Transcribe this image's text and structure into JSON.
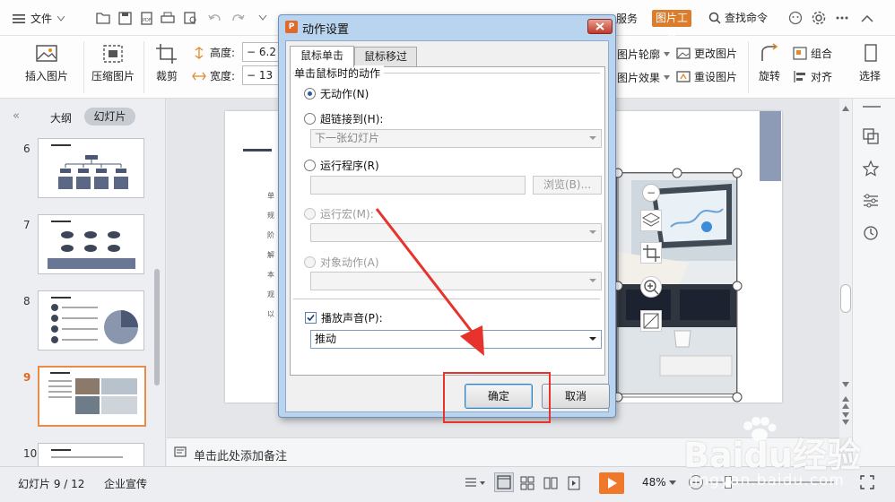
{
  "menu": {
    "file_label": "文件",
    "tools_partial": "服务",
    "picture_tools": "图片工具",
    "search_command": "查找命令"
  },
  "ribbon": {
    "insert_picture": "插入图片",
    "compress_picture": "压缩图片",
    "crop": "裁剪",
    "height_label": "高度:",
    "height_value": "6.2",
    "width_label": "宽度:",
    "width_value": "13",
    "picture_outline": "图片轮廓",
    "picture_effect": "图片效果",
    "change_picture": "更改图片",
    "reset_picture": "重设图片",
    "rotate": "旋转",
    "group": "组合",
    "align": "对齐",
    "select": "选择"
  },
  "left_panel": {
    "tab_outline": "大纲",
    "tab_slides": "幻灯片",
    "slide_numbers": [
      "6",
      "7",
      "8",
      "9",
      "10"
    ]
  },
  "slide_text_lines": [
    "单",
    "规",
    "阶",
    "解",
    "本",
    "观",
    "以"
  ],
  "notes_placeholder": "单击此处添加备注",
  "status": {
    "slide_counter": "幻灯片 9 / 12",
    "theme": "企业宣传",
    "zoom": "48%"
  },
  "dialog": {
    "title": "动作设置",
    "tabs": [
      "鼠标单击",
      "鼠标移过"
    ],
    "group_label": "单击鼠标时的动作",
    "options": [
      {
        "label": "无动作(N)",
        "checked": true,
        "enabled": true
      },
      {
        "label": "超链接到(H):",
        "checked": false,
        "enabled": true
      },
      {
        "label": "运行程序(R)",
        "checked": false,
        "enabled": true
      },
      {
        "label": "运行宏(M):",
        "checked": false,
        "enabled": false
      },
      {
        "label": "对象动作(A)",
        "checked": false,
        "enabled": false
      }
    ],
    "hyperlink_value": "下一张幻灯片",
    "browse_label": "浏览(B)...",
    "play_sound_label": "播放声音(P):",
    "play_sound_checked": true,
    "sound_value": "推动",
    "ok_label": "确定",
    "cancel_label": "取消"
  },
  "watermark": {
    "brand": "Baidu经验",
    "url": "jingyan.baidu.com"
  },
  "colors": {
    "accent": "#dc7c2d",
    "annotation_red": "#e8322c",
    "play_orange": "#f0782a",
    "selection_border": "#e88c48"
  }
}
